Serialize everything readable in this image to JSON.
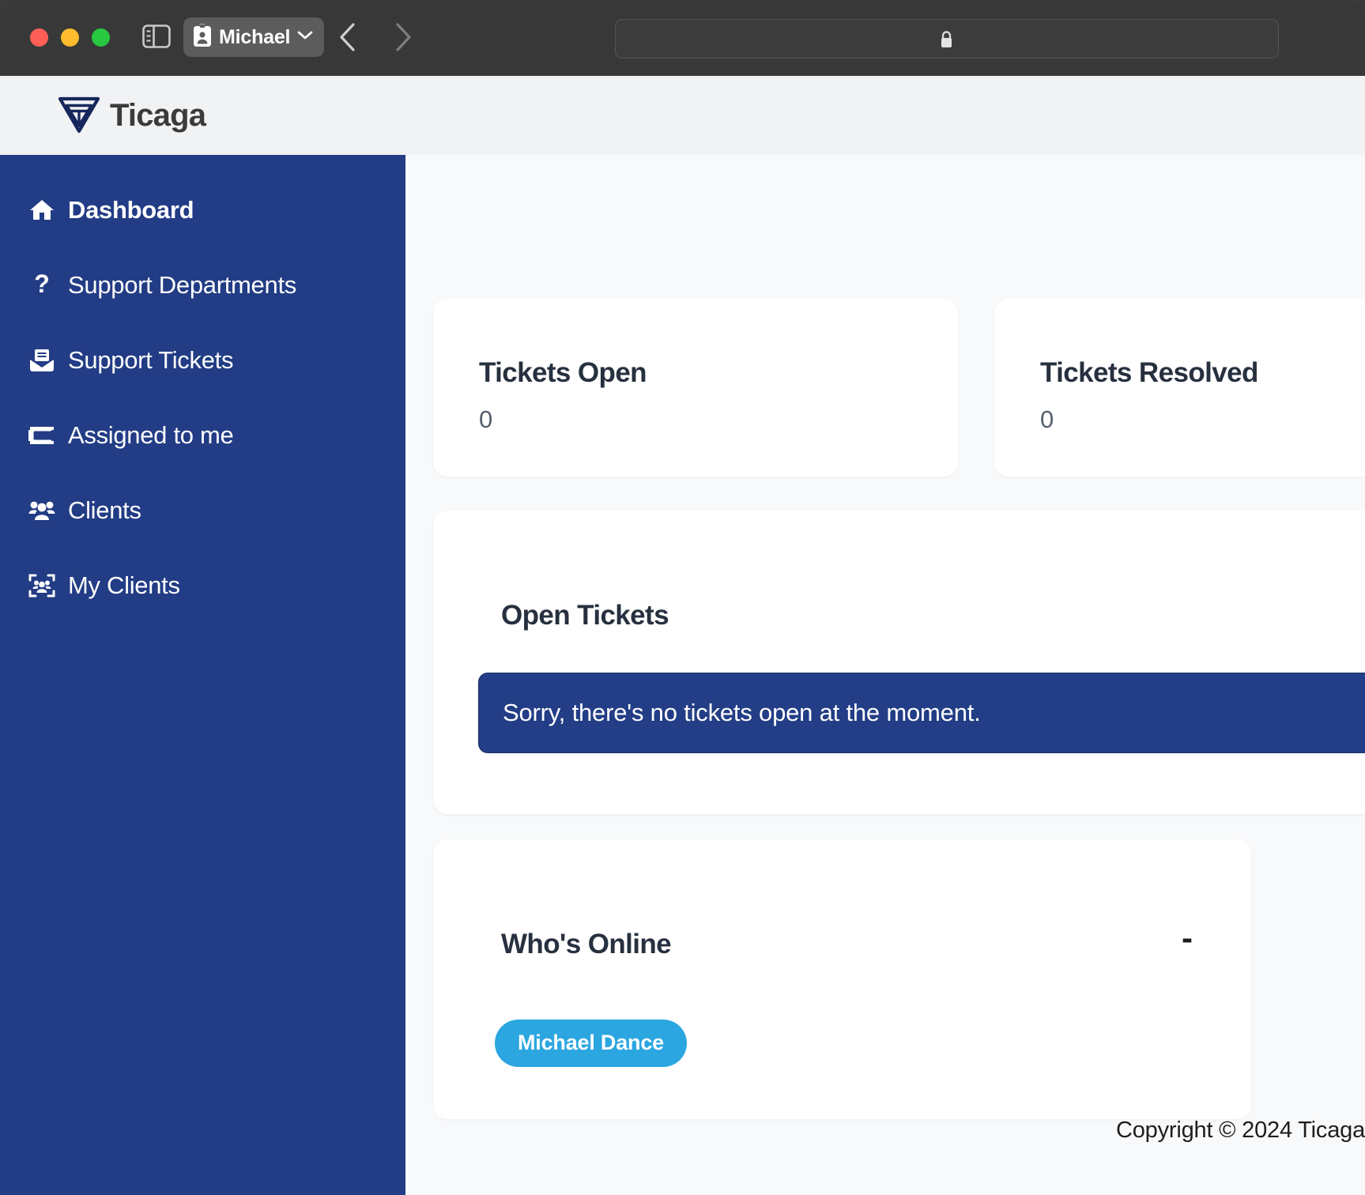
{
  "browser": {
    "traffic_lights": [
      "close",
      "minimize",
      "maximize"
    ],
    "sidebar_toggle_icon": "sidebar-toggle-icon",
    "profile": {
      "icon": "contact-card-icon",
      "label": "Michael",
      "chevron": "chevron-down-icon"
    },
    "nav_back_icon": "chevron-left-icon",
    "nav_forward_icon": "chevron-right-icon",
    "urlbar": {
      "lock_icon": "lock-icon",
      "url": ""
    }
  },
  "app": {
    "brand": {
      "logo_icon": "ticaga-triangle-logo",
      "name": "Ticaga"
    },
    "colors": {
      "sidebar_navy": "#223c85",
      "alert_navy": "#233e86",
      "badge_blue": "#2ba6e0",
      "page_bg": "#f8f9fb",
      "header_bg": "#f1f2f4",
      "card_bg": "#ffffff",
      "heading_text": "#27303f"
    }
  },
  "sidebar": {
    "items": [
      {
        "label": "Dashboard",
        "icon": "home-icon",
        "active": true
      },
      {
        "label": "Support Departments",
        "icon": "question-mark-icon",
        "active": false
      },
      {
        "label": "Support Tickets",
        "icon": "mail-open-icon",
        "active": false
      },
      {
        "label": "Assigned to me",
        "icon": "ticket-icon",
        "active": false
      },
      {
        "label": "Clients",
        "icon": "people-group-icon",
        "active": false
      },
      {
        "label": "My Clients",
        "icon": "people-focus-frame-icon",
        "active": false
      }
    ]
  },
  "main": {
    "stats": [
      {
        "title": "Tickets Open",
        "value": "0"
      },
      {
        "title": "Tickets Resolved",
        "value": "0"
      }
    ],
    "open_tickets": {
      "title": "Open Tickets",
      "empty_message": "Sorry, there's no tickets open at the moment."
    },
    "whos_online": {
      "title": "Who's Online",
      "collapse_label": "-",
      "users": [
        "Michael Dance"
      ]
    }
  },
  "footer": {
    "copyright": "Copyright © 2024 Ticaga"
  }
}
